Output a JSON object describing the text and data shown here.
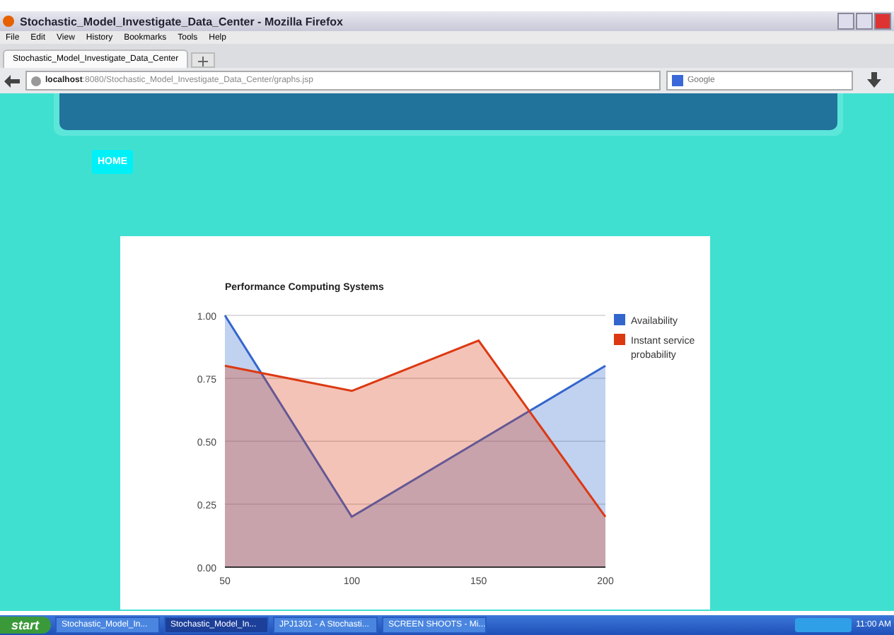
{
  "window": {
    "title": "Stochastic_Model_Investigate_Data_Center - Mozilla Firefox"
  },
  "menu": [
    "File",
    "Edit",
    "View",
    "History",
    "Bookmarks",
    "Tools",
    "Help"
  ],
  "tabs": [
    {
      "label": "Stochastic_Model_Investigate_Data_Center",
      "selected": true
    }
  ],
  "address_bar": {
    "host": "localhost",
    "path": ":8080/Stochastic_Model_Investigate_Data_Center/graphs.jsp"
  },
  "search": {
    "placeholder": "Google"
  },
  "nav": [
    {
      "label": "HOME",
      "selected": true
    }
  ],
  "chart": {
    "chart_data": {
      "type": "area",
      "title": "Performance Computing Systems",
      "categories": [
        "50",
        "100",
        "150",
        "200"
      ],
      "ylim": [
        0,
        1
      ],
      "yticks": [
        {
          "value": 0,
          "label": "0.00"
        },
        {
          "value": 0.25,
          "label": "0.25"
        },
        {
          "value": 0.5,
          "label": "0.50"
        },
        {
          "value": 0.75,
          "label": "0.75"
        },
        {
          "value": 1,
          "label": "1.00"
        }
      ],
      "stacked": false,
      "grid": true,
      "legend": "right",
      "series": [
        {
          "name": "Availability",
          "color": "#3366cc",
          "values": [
            1,
            0.2,
            0.5,
            0.8
          ]
        },
        {
          "name": "Instant service probability",
          "color": "#dc3912",
          "values": [
            0.8,
            0.7,
            0.9,
            0.2
          ]
        }
      ]
    }
  },
  "taskbar": {
    "start": "start",
    "items": [
      {
        "label": "Stochastic_Model_In...",
        "selected": false
      },
      {
        "label": "Stochastic_Model_In...",
        "selected": true
      },
      {
        "label": "JPJ1301 - A Stochasti...",
        "selected": false
      },
      {
        "label": "SCREEN SHOOTS - Mi...",
        "selected": false
      }
    ],
    "clock": "11:00 AM"
  }
}
